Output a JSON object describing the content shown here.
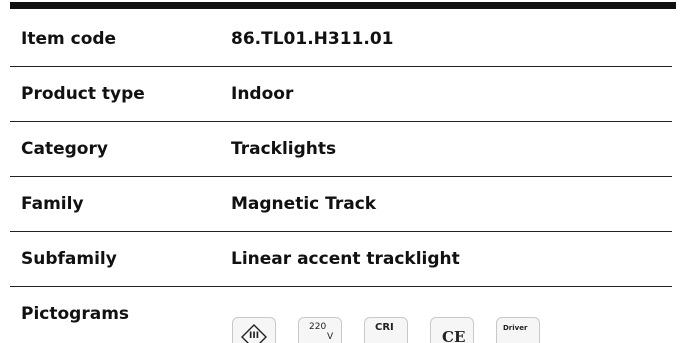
{
  "spec_table": {
    "rows": [
      {
        "label": "Item code",
        "value": "86.TL01.H311.01"
      },
      {
        "label": "Product type",
        "value": "Indoor"
      },
      {
        "label": "Category",
        "value": "Tracklights"
      },
      {
        "label": "Family",
        "value": "Magnetic Track"
      },
      {
        "label": "Subfamily",
        "value": "Linear accent tracklight"
      },
      {
        "label": "Pictograms",
        "value": ""
      }
    ]
  },
  "pictograms": [
    {
      "icon": "class-iii-icon",
      "text": "III"
    },
    {
      "icon": "voltage-icon",
      "text": "220",
      "sub": "V"
    },
    {
      "icon": "cri-icon",
      "text": "CRI"
    },
    {
      "icon": "ce-mark-icon",
      "text": "CE"
    },
    {
      "icon": "driver-icon",
      "text": "Driver"
    }
  ]
}
